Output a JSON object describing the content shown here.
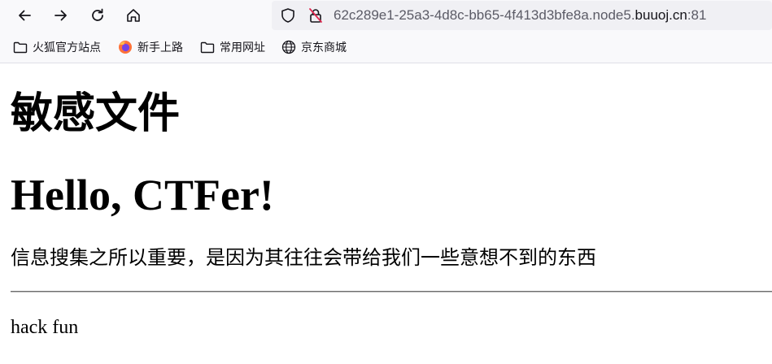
{
  "browser": {
    "nav": {
      "back": "back-arrow-icon",
      "forward": "forward-arrow-icon",
      "reload": "reload-icon",
      "home": "home-icon"
    },
    "url": {
      "prefix": "62c289e1-25a3-4d8c-bb65-4f413d3bfe8a.node5.",
      "domain": "buuoj.cn",
      "port": ":81"
    },
    "bookmarks": [
      {
        "label": "火狐官方站点",
        "icon": "folder-icon"
      },
      {
        "label": "新手上路",
        "icon": "firefox-icon"
      },
      {
        "label": "常用网址",
        "icon": "folder-icon"
      },
      {
        "label": "京东商城",
        "icon": "globe-icon"
      }
    ]
  },
  "page": {
    "title": "敏感文件",
    "heading": "Hello, CTFer!",
    "paragraph": "信息搜集之所以重要，是因为其往往会带给我们一些意想不到的东西",
    "footer_text": "hack fun"
  },
  "colors": {
    "toolbar_bg": "#f9f9fb",
    "urlbar_bg": "#f0f0f4",
    "url_text": "#5b5b66",
    "icon": "#15141a",
    "firefox_orange": "#ff7139",
    "firefox_purple": "#7542e5"
  }
}
